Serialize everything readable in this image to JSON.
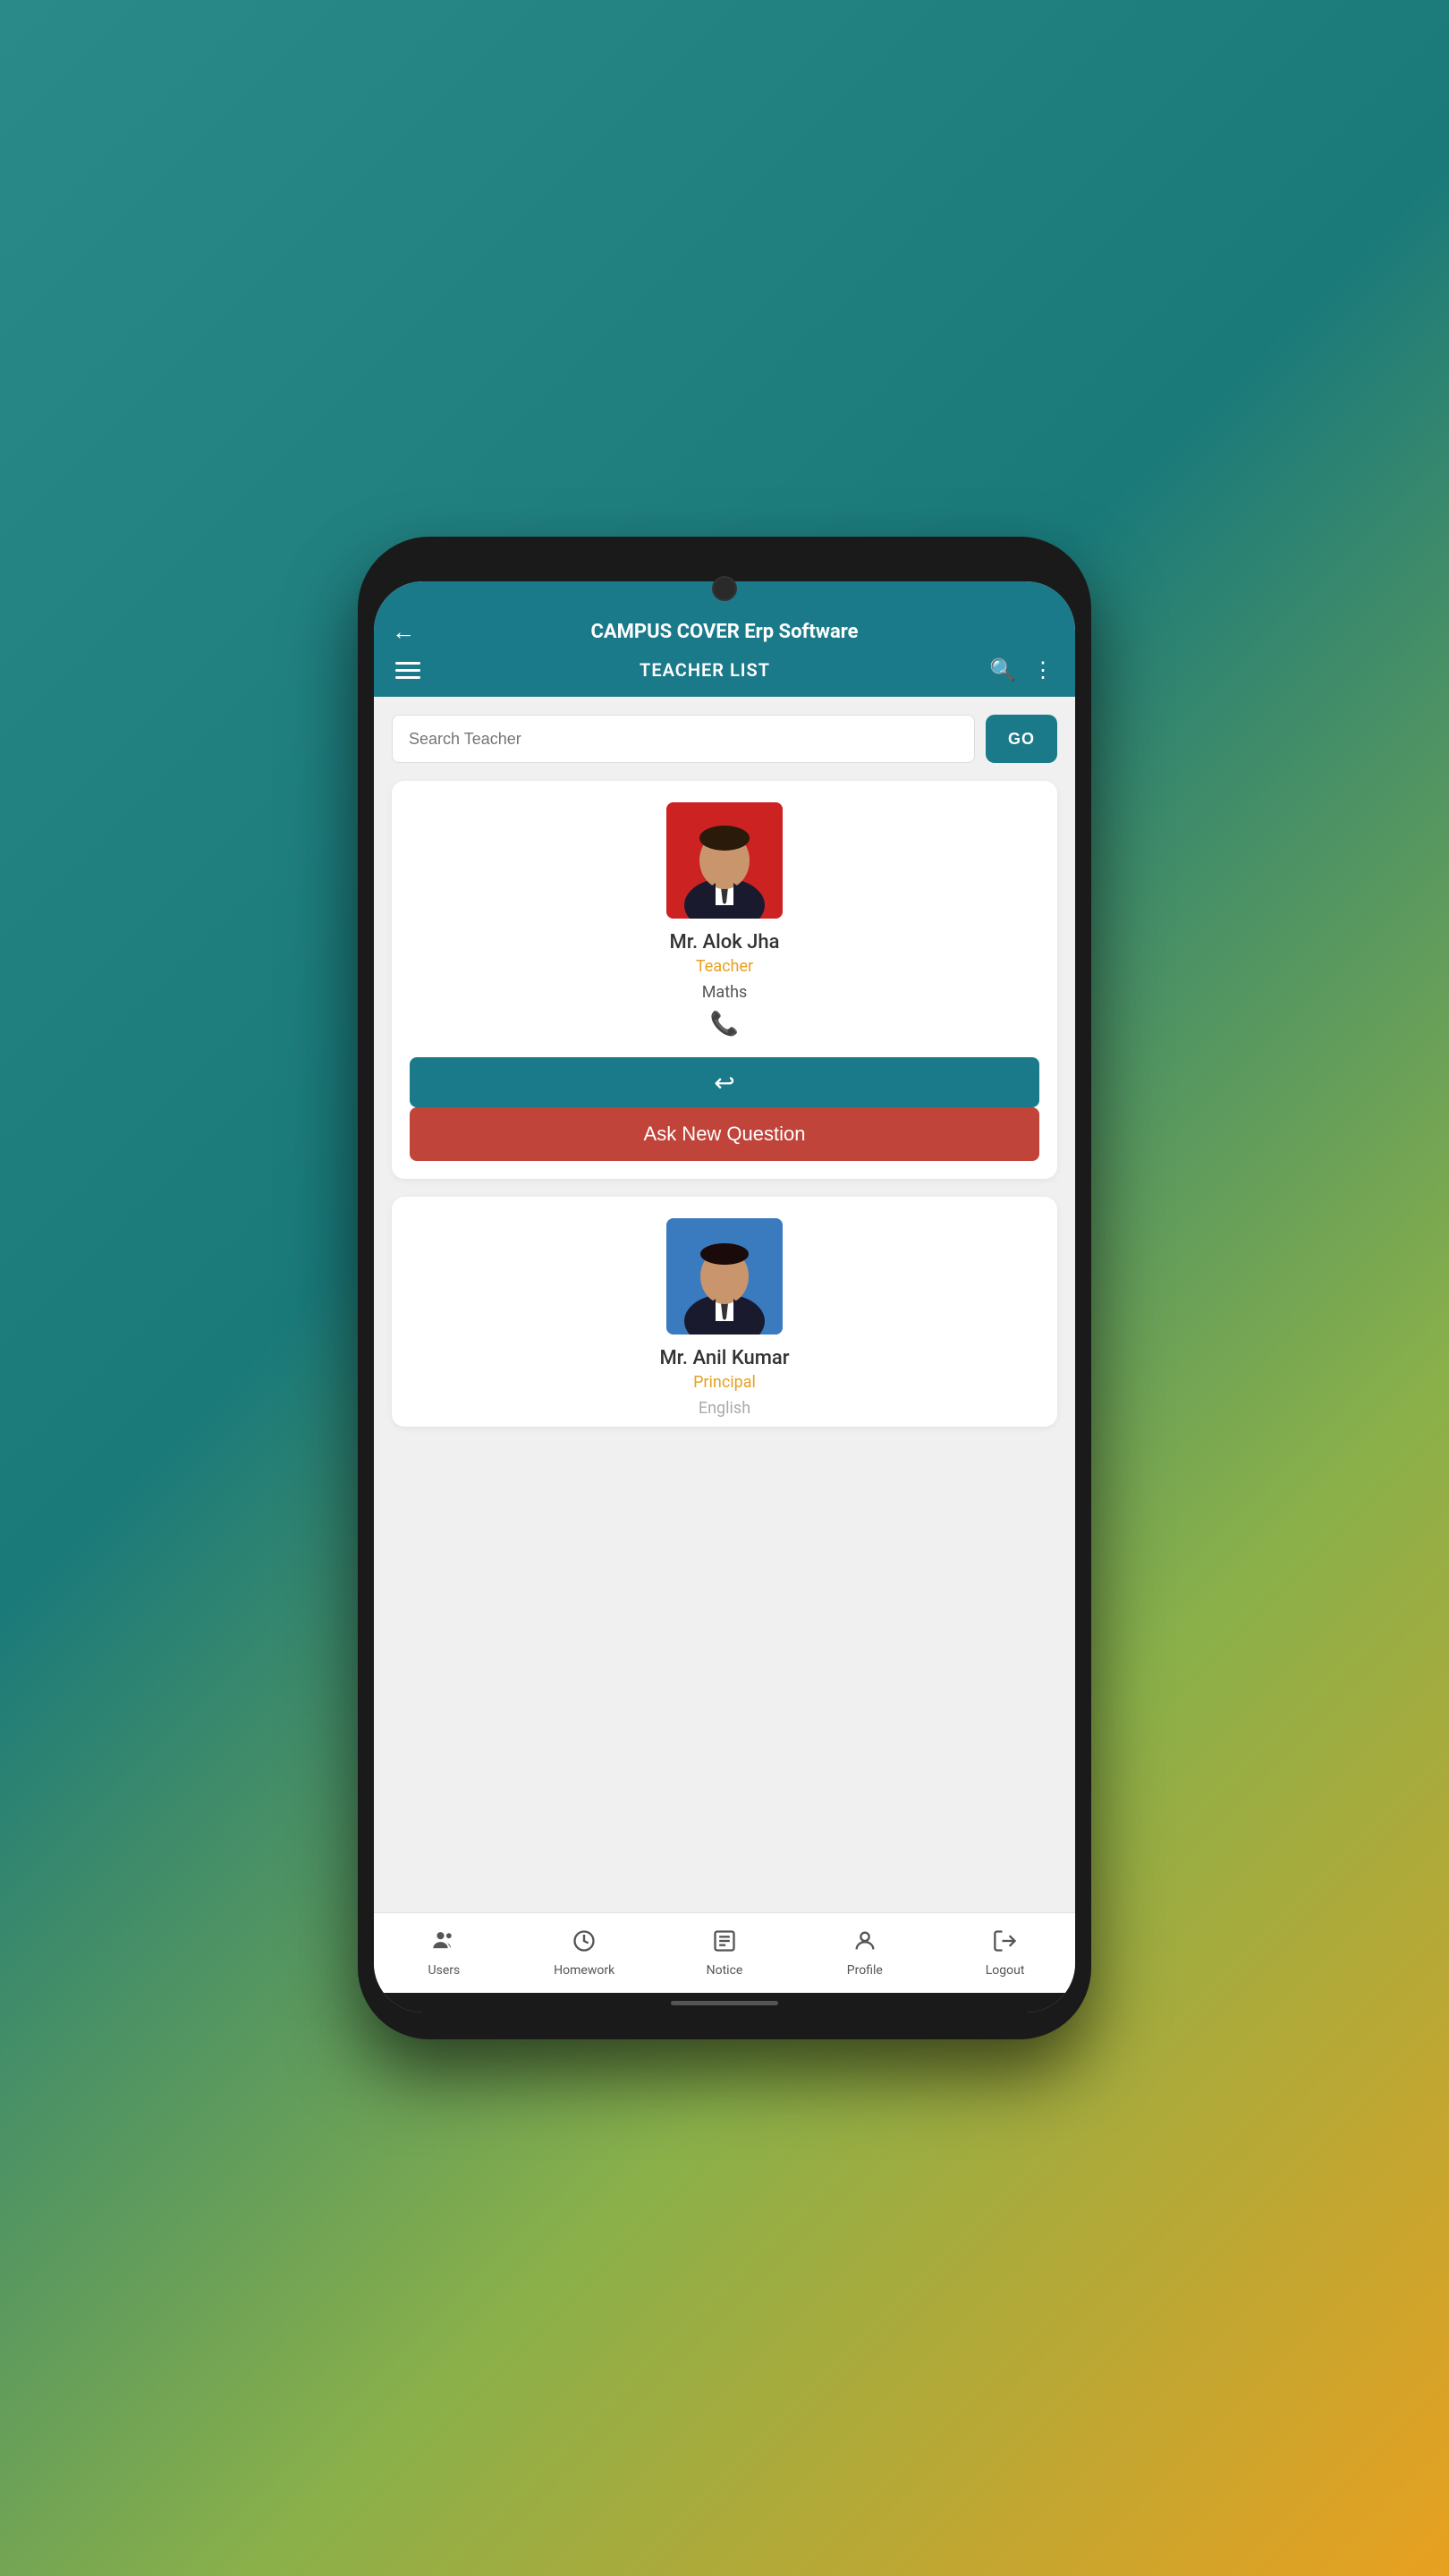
{
  "app": {
    "title": "CAMPUS COVER Erp Software",
    "toolbar_title": "TEACHER LIST"
  },
  "search": {
    "placeholder": "Search Teacher",
    "go_label": "GO"
  },
  "teachers": [
    {
      "name": "Mr. Alok Jha",
      "role": "Teacher",
      "subject": "Maths",
      "avatar_bg": "red"
    },
    {
      "name": "Mr. Anil Kumar",
      "role": "Principal",
      "subject": "English",
      "avatar_bg": "blue"
    }
  ],
  "buttons": {
    "ask_question": "Ask New Question",
    "reply_icon": "↩"
  },
  "nav": {
    "items": [
      {
        "label": "Users",
        "icon": "👥"
      },
      {
        "label": "Homework",
        "icon": "🕐"
      },
      {
        "label": "Notice",
        "icon": "📋"
      },
      {
        "label": "Profile",
        "icon": "👤"
      },
      {
        "label": "Logout",
        "icon": "🚪"
      }
    ]
  }
}
